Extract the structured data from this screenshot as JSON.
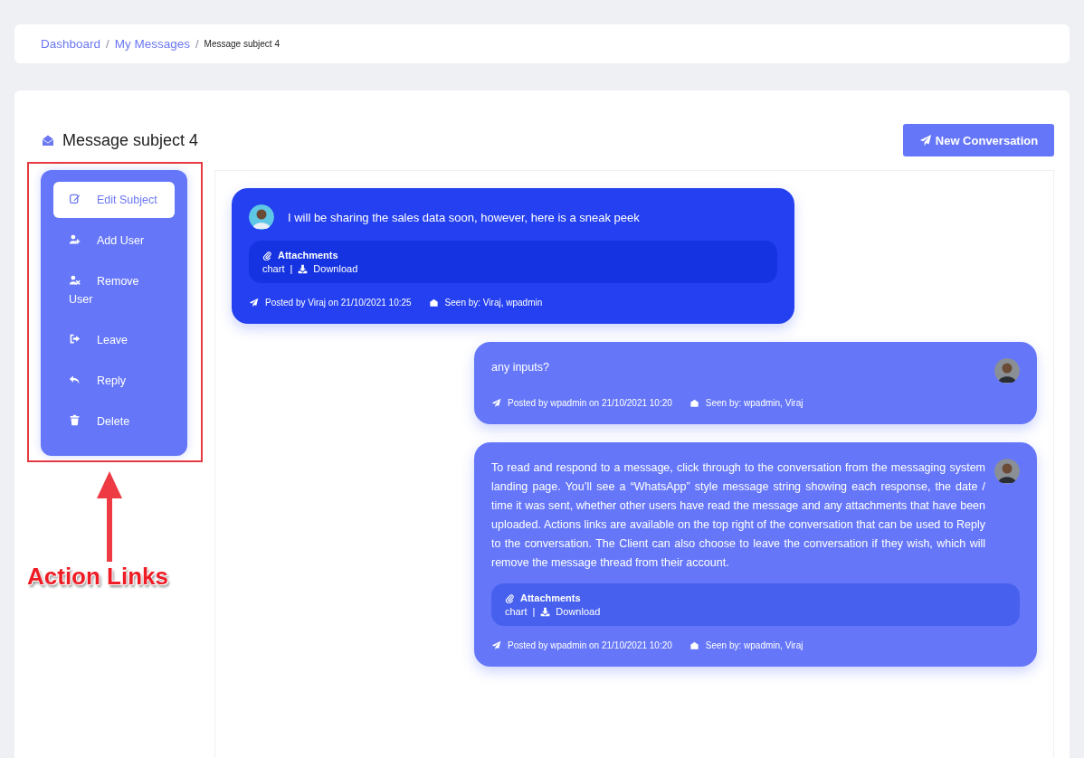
{
  "breadcrumb": [
    {
      "label": "Dashboard",
      "kind": "link"
    },
    {
      "label": "/",
      "kind": "separator"
    },
    {
      "label": "My Messages",
      "kind": "link"
    },
    {
      "label": "/",
      "kind": "separator"
    },
    {
      "label": "Message subject 4",
      "kind": "current"
    }
  ],
  "title": "Message subject 4",
  "new_button": "New Conversation",
  "actions": [
    {
      "label": "Edit Subject",
      "selected": true
    },
    {
      "label": "Add User",
      "selected": false
    },
    {
      "label": "Remove User",
      "selected": false
    },
    {
      "label": "Leave",
      "selected": false
    },
    {
      "label": "Reply",
      "selected": false
    },
    {
      "label": "Delete",
      "selected": false
    }
  ],
  "messages": [
    {
      "kind": "received",
      "text": "I will be sharing the sales data soon, however, here is a sneak peek",
      "attachments": {
        "title": "Attachments",
        "file": "chart",
        "separator": "|",
        "download": "Download"
      },
      "posted": "Posted by Viraj on 21/10/2021 10:25",
      "seen": "Seen by: Viraj, wpadmin"
    },
    {
      "kind": "sent",
      "text": "any inputs?",
      "posted": "Posted by wpadmin on 21/10/2021 10:20",
      "seen": "Seen by: wpadmin, Viraj"
    },
    {
      "kind": "sent",
      "text": "To read and respond to a message, click through to the conversation from the messaging system landing page. You’ll see a “WhatsApp” style message string showing each response, the date / time it was sent, whether other users have read the message and any attachments that have been uploaded. Actions links are available on the top right of the conversation that can be used to Reply to the conversation. The Client can also choose to leave the conversation if they wish, which will remove the message thread from their account.",
      "attachments": {
        "title": "Attachments",
        "file": "chart",
        "separator": "|",
        "download": "Download"
      },
      "posted": "Posted by wpadmin on 21/10/2021 10:20",
      "seen": "Seen by: wpadmin, Viraj"
    }
  ],
  "annotation": {
    "label": "Action Links"
  }
}
